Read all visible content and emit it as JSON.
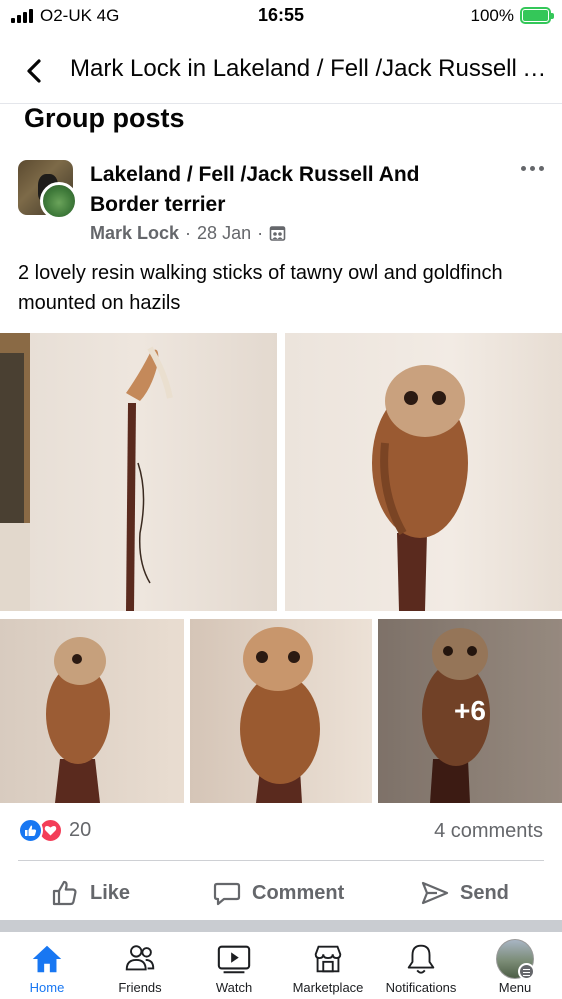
{
  "status_bar": {
    "carrier": "O2-UK  4G",
    "time": "16:55",
    "battery": "100%",
    "battery_level": 1.0
  },
  "header": {
    "back_icon": "chevron-left-icon",
    "title": "Mark Lock in Lakeland / Fell /Jack Russell And Border terrier"
  },
  "section_title": "Group posts",
  "post": {
    "group_name": "Lakeland / Fell /Jack Russell And Border terrier",
    "author": "Mark Lock",
    "date": "28 Jan",
    "separator": "·",
    "audience_icon": "group-audience-icon",
    "more_icon": "more-horizontal-icon",
    "text": "2 lovely resin walking sticks of tawny owl and goldfinch mounted on hazils",
    "photos": [
      {
        "subject": "goldfinch-walking-stick"
      },
      {
        "subject": "tawny-owl-walking-stick"
      },
      {
        "subject": "tawny-owl-left"
      },
      {
        "subject": "tawny-owl-front"
      },
      {
        "subject": "tawny-owl-more"
      }
    ],
    "more_photos_label": "+6",
    "reactions": {
      "types": [
        "like",
        "love"
      ],
      "count": "20"
    },
    "comments_count": "4 comments",
    "actions": {
      "like": "Like",
      "comment": "Comment",
      "send": "Send"
    }
  },
  "tabbar": {
    "active": "Home",
    "tabs": [
      {
        "label": "Home",
        "icon": "home-icon"
      },
      {
        "label": "Friends",
        "icon": "friends-icon"
      },
      {
        "label": "Watch",
        "icon": "watch-icon"
      },
      {
        "label": "Marketplace",
        "icon": "marketplace-icon"
      },
      {
        "label": "Notifications",
        "icon": "bell-icon"
      },
      {
        "label": "Menu",
        "icon": "menu-avatar-icon"
      }
    ]
  },
  "colors": {
    "accent": "#1877f2",
    "love": "#f33e58",
    "secondary_text": "#65676b",
    "battery": "#34c759"
  }
}
